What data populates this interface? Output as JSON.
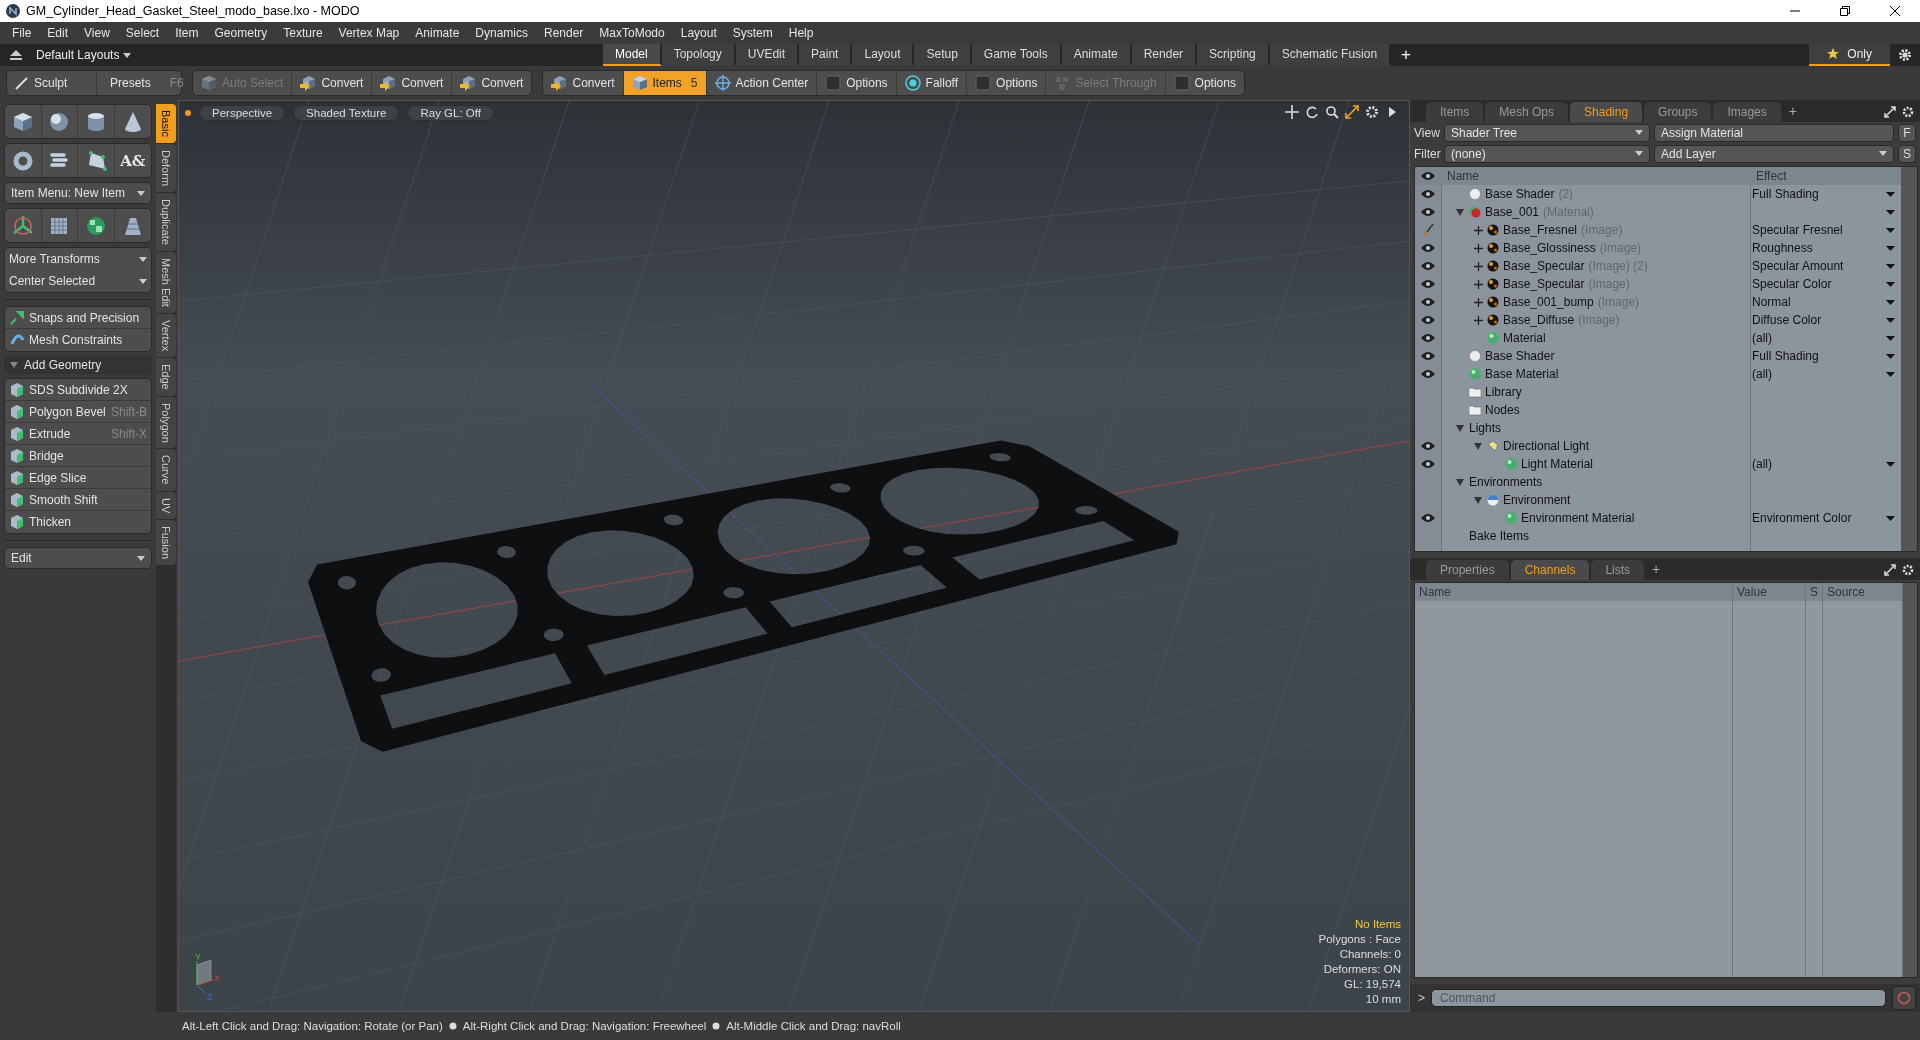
{
  "window": {
    "title": "GM_Cylinder_Head_Gasket_Steel_modo_base.lxo - MODO"
  },
  "menu": [
    "File",
    "Edit",
    "View",
    "Select",
    "Item",
    "Geometry",
    "Texture",
    "Vertex Map",
    "Animate",
    "Dynamics",
    "Render",
    "MaxToModo",
    "Layout",
    "System",
    "Help"
  ],
  "layout_bar": {
    "layouts_label": "Default Layouts",
    "tabs": [
      {
        "label": "Model",
        "selected": true
      },
      {
        "label": "Topology",
        "selected": false
      },
      {
        "label": "UVEdit",
        "selected": false
      },
      {
        "label": "Paint",
        "selected": false
      },
      {
        "label": "Layout",
        "selected": false
      },
      {
        "label": "Setup",
        "selected": false
      },
      {
        "label": "Game Tools",
        "selected": false
      },
      {
        "label": "Animate",
        "selected": false
      },
      {
        "label": "Render",
        "selected": false
      },
      {
        "label": "Scripting",
        "selected": false
      },
      {
        "label": "Schematic Fusion",
        "selected": false
      }
    ],
    "add_tab": "+",
    "only": {
      "label": "Only",
      "on": true
    }
  },
  "toolbar": {
    "sculpt": "Sculpt",
    "presets": {
      "label": "Presets",
      "shortcut": "F6"
    },
    "groups": [
      [
        {
          "label": "Auto Select",
          "disabled": true,
          "selected": false
        },
        {
          "label": "Convert",
          "disabled": false,
          "selected": false
        },
        {
          "label": "Convert",
          "disabled": false,
          "selected": false
        },
        {
          "label": "Convert",
          "disabled": false,
          "selected": false
        }
      ],
      [
        {
          "label": "Convert",
          "disabled": false,
          "selected": false
        },
        {
          "label": "Items",
          "disabled": false,
          "selected": true,
          "shortcut": "5"
        },
        {
          "label": "Action Center",
          "disabled": false,
          "selected": false
        },
        {
          "label": "Options",
          "disabled": false,
          "selected": false
        },
        {
          "label": "Falloff",
          "disabled": false,
          "selected": false
        },
        {
          "label": "Options",
          "disabled": false,
          "selected": false
        },
        {
          "label": "Select Through",
          "disabled": true,
          "selected": false
        },
        {
          "label": "Options",
          "disabled": false,
          "selected": false
        }
      ]
    ]
  },
  "left_panel": {
    "vertical_tabs": [
      {
        "label": "Basic",
        "selected": true
      },
      {
        "label": "Deform",
        "selected": false
      },
      {
        "label": "Duplicate",
        "selected": false
      },
      {
        "label": "Mesh Edit",
        "selected": false
      },
      {
        "label": "Vertex",
        "selected": false
      },
      {
        "label": "Edge",
        "selected": false
      },
      {
        "label": "Polygon",
        "selected": false
      },
      {
        "label": "Curve",
        "selected": false
      },
      {
        "label": "UV",
        "selected": false
      },
      {
        "label": "Fusion",
        "selected": false
      }
    ],
    "text_tool_glyph": "A&",
    "item_menu": "Item Menu: New Item",
    "transforms": [
      "More Transforms",
      "Center Selected"
    ],
    "snaps": [
      "Snaps and Precision",
      "Mesh Constraints"
    ],
    "add_geometry": {
      "label": "Add Geometry",
      "expanded": true,
      "tools": [
        {
          "label": "SDS Subdivide 2X"
        },
        {
          "label": "Polygon Bevel",
          "shortcut": "Shift-B"
        },
        {
          "label": "Extrude",
          "shortcut": "Shift-X"
        },
        {
          "label": "Bridge"
        },
        {
          "label": "Edge Slice"
        },
        {
          "label": "Smooth Shift"
        },
        {
          "label": "Thicken"
        }
      ]
    },
    "edit": "Edit"
  },
  "viewport": {
    "header": [
      "Perspective",
      "Shaded Texture",
      "Ray GL: Off"
    ],
    "info": [
      {
        "text": "No Items",
        "highlighted": true
      },
      {
        "text": "Polygons : Face",
        "highlighted": false
      },
      {
        "text": "Channels: 0",
        "highlighted": false
      },
      {
        "text": "Deformers: ON",
        "highlighted": false
      },
      {
        "text": "GL: 19,574",
        "highlighted": false
      },
      {
        "text": "10 mm",
        "highlighted": false
      }
    ],
    "axes": {
      "x": "X",
      "y": "Y",
      "z": "Z"
    }
  },
  "shading_panel": {
    "tabs": [
      {
        "label": "Items",
        "selected": false
      },
      {
        "label": "Mesh Ops",
        "selected": false
      },
      {
        "label": "Shading",
        "selected": true
      },
      {
        "label": "Groups",
        "selected": false
      },
      {
        "label": "Images",
        "selected": false
      }
    ],
    "add_tab": "+",
    "view": {
      "label": "View",
      "value": "Shader Tree"
    },
    "assign": "Assign Material",
    "assign_key": "F",
    "filter": {
      "label": "Filter",
      "value": "(none)"
    },
    "add_layer": "Add Layer",
    "add_layer_key": "S",
    "columns": [
      "Name",
      "Effect"
    ],
    "tree": [
      {
        "kind": "shader",
        "name": "Base Shader",
        "note": "(2)",
        "effect": "Full Shading",
        "effect_dropdown": true,
        "visible": true,
        "collapsible": false
      },
      {
        "kind": "mask",
        "name": "Base_001",
        "note": "(Material)",
        "effect_dropdown": true,
        "visible": true,
        "collapsible": true,
        "expanded": true,
        "children": [
          {
            "kind": "paint_image",
            "name": "Base_Fresnel",
            "note": "(Image)",
            "effect": "Specular Fresnel",
            "effect_dropdown": true,
            "visible": true,
            "collapsible": true,
            "expanded": false
          },
          {
            "kind": "image",
            "name": "Base_Glossiness",
            "note": "(Image)",
            "effect": "Roughness",
            "effect_dropdown": true,
            "visible": true,
            "collapsible": true,
            "expanded": false
          },
          {
            "kind": "image",
            "name": "Base_Specular",
            "note": "(Image) (2)",
            "effect": "Specular Amount",
            "effect_dropdown": true,
            "visible": true,
            "collapsible": true,
            "expanded": false
          },
          {
            "kind": "image",
            "name": "Base_Specular",
            "note": "(Image)",
            "effect": "Specular Color",
            "effect_dropdown": true,
            "visible": true,
            "collapsible": true,
            "expanded": false
          },
          {
            "kind": "image",
            "name": "Base_001_bump",
            "note": "(Image)",
            "effect": "Normal",
            "effect_dropdown": true,
            "visible": true,
            "collapsible": true,
            "expanded": false
          },
          {
            "kind": "image",
            "name": "Base_Diffuse",
            "note": "(Image)",
            "effect": "Diffuse Color",
            "effect_dropdown": true,
            "visible": true,
            "collapsible": true,
            "expanded": false
          },
          {
            "kind": "material",
            "name": "Material",
            "effect": "(all)",
            "effect_dropdown": true,
            "visible": true,
            "collapsible": false
          }
        ]
      },
      {
        "kind": "shader",
        "name": "Base Shader",
        "effect": "Full Shading",
        "effect_dropdown": true,
        "visible": true,
        "collapsible": false
      },
      {
        "kind": "material",
        "name": "Base Material",
        "effect": "(all)",
        "effect_dropdown": true,
        "visible": true,
        "collapsible": false
      },
      {
        "kind": "folder",
        "name": "Library",
        "effect_dropdown": false,
        "visible": false,
        "collapsible": false
      },
      {
        "kind": "folder",
        "name": "Nodes",
        "effect_dropdown": false,
        "visible": false,
        "collapsible": false
      },
      {
        "kind": "group",
        "name": "Lights",
        "effect_dropdown": false,
        "visible": false,
        "collapsible": true,
        "expanded": true,
        "children": [
          {
            "kind": "light",
            "name": "Directional Light",
            "effect_dropdown": false,
            "visible": true,
            "collapsible": true,
            "expanded": true,
            "children": [
              {
                "kind": "material",
                "name": "Light Material",
                "effect": "(all)",
                "effect_dropdown": true,
                "visible": true,
                "collapsible": false
              }
            ]
          }
        ]
      },
      {
        "kind": "group",
        "name": "Environments",
        "effect_dropdown": false,
        "visible": false,
        "collapsible": true,
        "expanded": true,
        "children": [
          {
            "kind": "environment",
            "name": "Environment",
            "effect_dropdown": false,
            "visible": false,
            "collapsible": true,
            "expanded": true,
            "children": [
              {
                "kind": "material",
                "name": "Environment Material",
                "effect": "Environment Color",
                "effect_dropdown": true,
                "visible": true,
                "collapsible": false
              }
            ]
          }
        ]
      },
      {
        "kind": "group",
        "name": "Bake Items",
        "effect_dropdown": false,
        "visible": false,
        "collapsible": false
      }
    ]
  },
  "channels_panel": {
    "tabs": [
      {
        "label": "Properties",
        "selected": false
      },
      {
        "label": "Channels",
        "selected": true
      },
      {
        "label": "Lists",
        "selected": false
      }
    ],
    "add_tab": "+",
    "columns": [
      "Name",
      "Value",
      "S",
      "Source"
    ],
    "command": {
      "prompt": ">",
      "placeholder": "Command"
    }
  },
  "status_bar": {
    "hints": [
      "Alt-Left Click and Drag: Navigation: Rotate (or Pan)",
      "Alt-Right Click and Drag: Navigation: Freewheel",
      "Alt-Middle Click and Drag: navRoll"
    ]
  }
}
